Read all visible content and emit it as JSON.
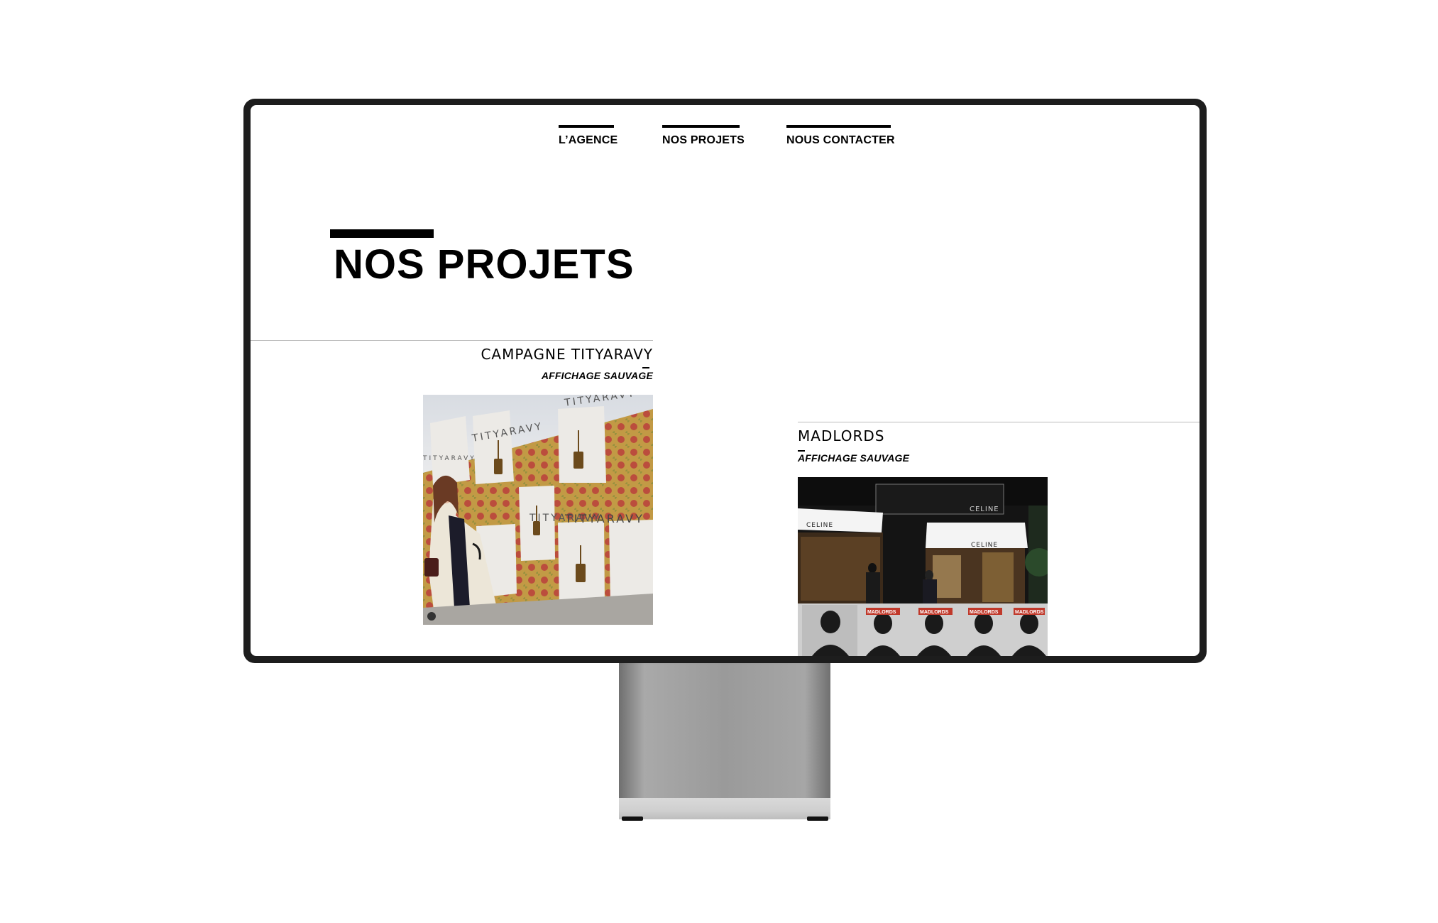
{
  "nav": {
    "items": [
      {
        "label": "L’AGENCE"
      },
      {
        "label": "NOS PROJETS"
      },
      {
        "label": "NOUS CONTACTER"
      }
    ]
  },
  "page": {
    "title": "NOS PROJETS"
  },
  "projects": [
    {
      "title": "CAMPAGNE TITYARAVY",
      "category": "AFFICHAGE SAUVAGE",
      "poster_text": [
        "TITYARAVY",
        "TITYARAVY",
        "TITYARAVY",
        "TITYARAVY",
        "TITYARAVY"
      ]
    },
    {
      "title": "MADLORDS",
      "category": "AFFICHAGE SAUVAGE",
      "store_sign_text": [
        "CELINE",
        "CELINE",
        "CELINE"
      ],
      "poster_text": [
        "MADLORDS",
        "MADLORDS",
        "MADLORDS",
        "MADLORDS"
      ]
    }
  ],
  "colors": {
    "bezel": "#1d1d1d",
    "accent": "#000000",
    "divider": "#bbbbbb"
  }
}
